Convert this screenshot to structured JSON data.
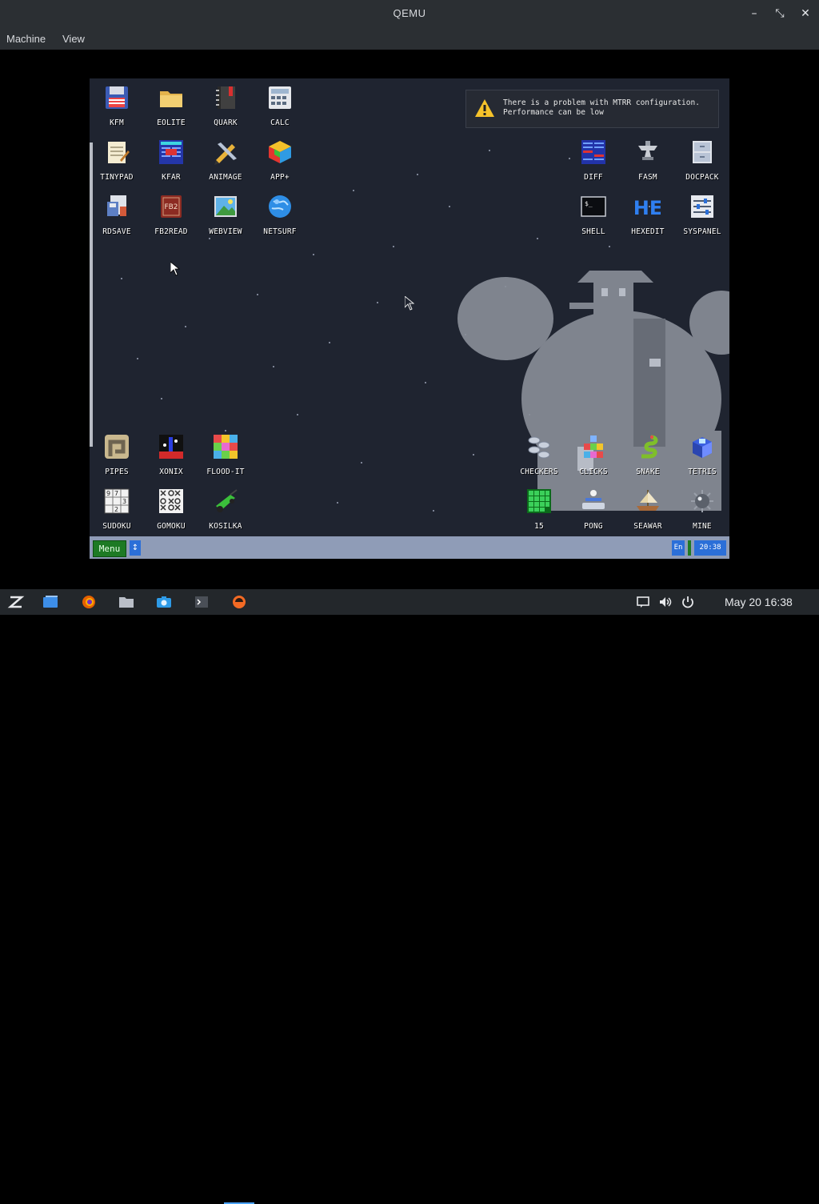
{
  "window": {
    "title": "QEMU",
    "controls": {
      "minimize": "–",
      "restore": "⤡",
      "close": "✕"
    }
  },
  "menubar": {
    "items": [
      "Machine",
      "View"
    ]
  },
  "desktop": {
    "icons_left": [
      {
        "label": "KFM",
        "icon": "floppy-icon"
      },
      {
        "label": "EOLITE",
        "icon": "folder-icon"
      },
      {
        "label": "QUARK",
        "icon": "notebook-icon"
      },
      {
        "label": "CALC",
        "icon": "calculator-icon"
      },
      {
        "label": "TINYPAD",
        "icon": "notepad-icon"
      },
      {
        "label": "KFAR",
        "icon": "file-manager-icon"
      },
      {
        "label": "ANIMAGE",
        "icon": "pencil-icon"
      },
      {
        "label": "APP+",
        "icon": "cube-icon"
      },
      {
        "label": "RDSAVE",
        "icon": "save-icon"
      },
      {
        "label": "FB2READ",
        "icon": "book-icon"
      },
      {
        "label": "WEBVIEW",
        "icon": "picture-icon"
      },
      {
        "label": "NETSURF",
        "icon": "globe-icon"
      }
    ],
    "icons_right": [
      {
        "label": "DIFF",
        "icon": "diff-icon"
      },
      {
        "label": "FASM",
        "icon": "anvil-icon"
      },
      {
        "label": "DOCPACK",
        "icon": "cabinet-icon"
      },
      {
        "label": "SHELL",
        "icon": "terminal-icon"
      },
      {
        "label": "HEXEDIT",
        "icon": "hex-icon"
      },
      {
        "label": "SYSPANEL",
        "icon": "sliders-icon"
      }
    ],
    "icons_bottom_left": [
      {
        "label": "PIPES",
        "icon": "pipes-icon"
      },
      {
        "label": "XONIX",
        "icon": "xonix-icon"
      },
      {
        "label": "FLOOD-IT",
        "icon": "flood-icon"
      },
      {
        "label": "SUDOKU",
        "icon": "sudoku-icon"
      },
      {
        "label": "GOMOKU",
        "icon": "gomoku-icon"
      },
      {
        "label": "KOSILKA",
        "icon": "mower-icon"
      }
    ],
    "icons_bottom_right": [
      {
        "label": "CHECKERS",
        "icon": "checkers-icon"
      },
      {
        "label": "CLICKS",
        "icon": "clicks-icon"
      },
      {
        "label": "SNAKE",
        "icon": "snake-icon"
      },
      {
        "label": "TETRIS",
        "icon": "tetris-icon"
      },
      {
        "label": "15",
        "icon": "fifteen-icon"
      },
      {
        "label": "PONG",
        "icon": "pong-icon"
      },
      {
        "label": "SEAWAR",
        "icon": "ship-icon"
      },
      {
        "label": "MINE",
        "icon": "mine-icon"
      }
    ]
  },
  "notification": {
    "line1": "There is a problem with MTRR configuration.",
    "line2": "Performance can be low"
  },
  "guest_taskbar": {
    "menu": "Menu",
    "switch": "↕",
    "lang": "En",
    "clock": "20:38"
  },
  "host_taskbar": {
    "clock": "May 20  16:38"
  },
  "colors": {
    "guest_bg": "#1f2430",
    "guest_taskbar": "#8f9cb7",
    "menu_green": "#1d7a24",
    "accent_blue": "#2b6fd8"
  }
}
